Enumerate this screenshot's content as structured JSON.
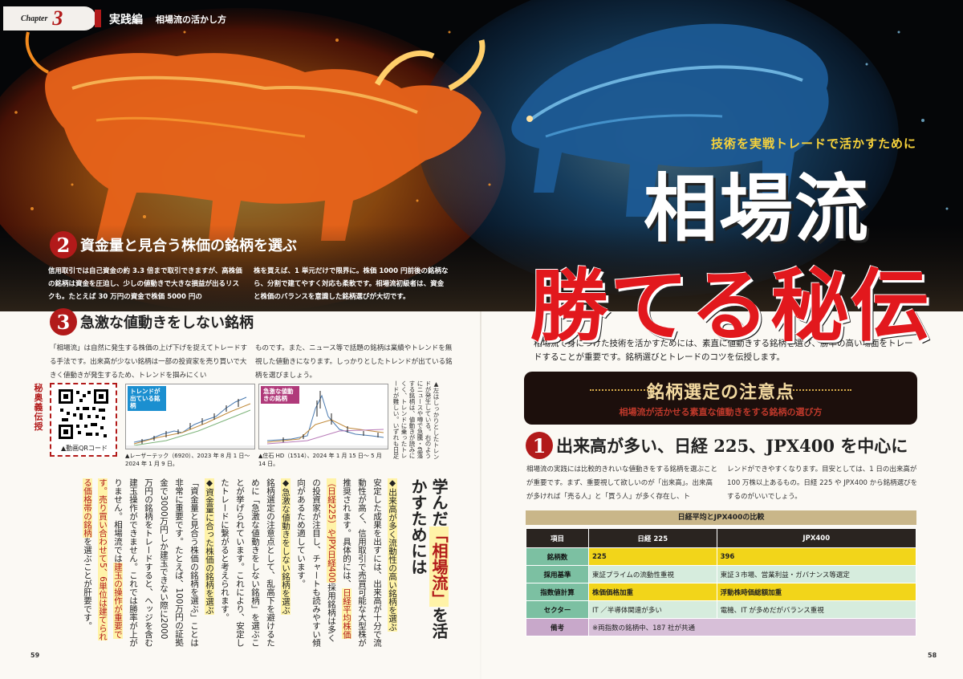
{
  "header": {
    "chapter_word": "Chapter",
    "chapter_number": "3",
    "section_kind": "実践編",
    "section_subtitle": "相場流の活かし方"
  },
  "hero": {
    "tagline": "技術を実戦トレードで活かすために",
    "title_line1": "相場流",
    "title_line2": "勝てる秘伝"
  },
  "section2": {
    "number": "2",
    "heading": "資金量と見合う株価の銘柄を選ぶ",
    "para_left": "信用取引では自己資金の約 3.3 倍まで取引できますが、高株価の銘柄は資金を圧迫し、少しの値動きで大きな損益が出るリスクも。たとえば 30 万円の資金で株価 5000 円の",
    "para_right": "株を買えば、1 単元だけで限界に。株価 1000 円前後の銘柄なら、分割で建てやすく対応も柔軟です。相場流初級者は、資金と株価のバランスを意識した銘柄選びが大切です。"
  },
  "section3": {
    "number": "3",
    "heading": "急激な値動きをしない銘柄",
    "para_left": "「相場流」は自然に発生する株価の上げ下げを捉えてトレードする手法です。出来高が少ない銘柄は一部の投資家を売り買いで大きく値動きが発生するため、トレンドを掴みにくい",
    "para_right": "ものです。また、ニュース等で話題の銘柄は業績やトレンドを無視した値動きになります。しっかりとしたトレンドが出ている銘柄を選びましょう。"
  },
  "stamp": "秘奥義伝授",
  "qr": {
    "label": "▲動画QRコード"
  },
  "chart1": {
    "tag": "トレンドが出ている銘柄",
    "caption": "▲レーザーテック（6920）、2023 年 8 月 1 日〜 2024 年 1 月 9 日。"
  },
  "chart2": {
    "tag": "急激な値動きの銘柄",
    "caption": "▲住石 HD（1514）、2024 年 1 月 15 日〜 5 月 14 日。"
  },
  "side_note": "▲左はしっかりとしたトレンドが発生している。右のようにニュースや噂で急騰・急落する銘柄は、値動きが読みにくく、トレンドに乗ったトレードが難しい。いずれも日足チャート。",
  "learned": {
    "head_pre": "学んだ",
    "head_key": "「相場流」",
    "head_post": "を活かすためには",
    "body": [
      {
        "t": "◆出来高が多く流動性の高い銘柄を選ぶ",
        "s": "mark"
      },
      {
        "t": "安定した成果を出すには、出来高が十分で流動性が高く、信用取引で売買可能な大型株が推奨されます。具体的には、",
        "s": ""
      },
      {
        "t": "日経平均株価（日経225）やJPX日経400",
        "s": "redm"
      },
      {
        "t": "採用銘柄は多くの投資家が注目し、チャートも読みやすい傾向があるため適しています。",
        "s": ""
      },
      {
        "t": "◆急激な値動きをしない銘柄を選ぶ",
        "s": "mark"
      },
      {
        "t": "銘柄選定の注意点として、乱高下を避けるために「急激な値動きをしない銘柄」を選ぶことが挙げられています。これにより、安定したトレードに繋がると考えられます。",
        "s": ""
      },
      {
        "t": "◆資金量に合った株価の銘柄を選ぶ",
        "s": "mark"
      },
      {
        "t": "「資金量と見合う株価の銘柄を選ぶ」ことは非常に重要です。たとえば、100万円の証拠金で3000万円しか建玉できない際に2000万円の銘柄をトレードすると、ヘッジを含む建玉操作ができません。これでは勝率が上がりません。相場流では",
        "s": ""
      },
      {
        "t": "建玉の操作が重要です。売り買い合わせて5、6単位は建てられる価格帯の銘柄",
        "s": "redm"
      },
      {
        "t": "を選ぶことが肝要です。",
        "s": ""
      }
    ]
  },
  "page_left": "59",
  "page_right": "58",
  "right_intro": "相場流で身につけた技術を活かすためには、素直に値動きする銘柄を選び、勝率の高い場面をトレードすることが重要です。銘柄選びとトレードのコツを伝授します。",
  "banner": {
    "title": "銘柄選定の注意点",
    "subtitle": "相場流が活かせる素直な値動きをする銘柄の選び方"
  },
  "section1": {
    "number": "1",
    "heading": "出来高が多い、日経 225、JPX400 を中心に",
    "para_left": "相場流の実践には比較的きれいな値動きをする銘柄を選ぶことが重要です。まず、重要視して欲しいのが「出来高」。出来高が多ければ「売る人」と「買う人」が多く存在し、ト",
    "para_right": "レンドができやすくなります。目安としては、1 日の出来高が 100 万株以上あるもの。日経 225 や JPX400 から銘柄選びをするのがいいでしょう。"
  },
  "table": {
    "caption": "日経平均とJPX400の比較",
    "headers": [
      "項目",
      "日経 225",
      "JPX400"
    ],
    "rows": [
      {
        "label": "銘柄数",
        "a": "225",
        "b": "396"
      },
      {
        "label": "採用基準",
        "a": "東証プライムの流動性重視",
        "b": "東証３市場、営業利益・ガバナンス等選定"
      },
      {
        "label": "指数値計算",
        "a": "株価価格加重",
        "b": "浮動株時価総額加重"
      },
      {
        "label": "セクター",
        "a": "IT ／半導体関連が多い",
        "b": "電機、IT が多めだがバランス重視"
      },
      {
        "label": "備考",
        "a": "※両指数の銘柄中、187 社が共通",
        "b": ""
      }
    ]
  },
  "colors": {
    "accent_red": "#b21a1a",
    "title_red": "#e2181d",
    "banner_bg": "#1c0f0c",
    "table_header": "#2a2420"
  }
}
